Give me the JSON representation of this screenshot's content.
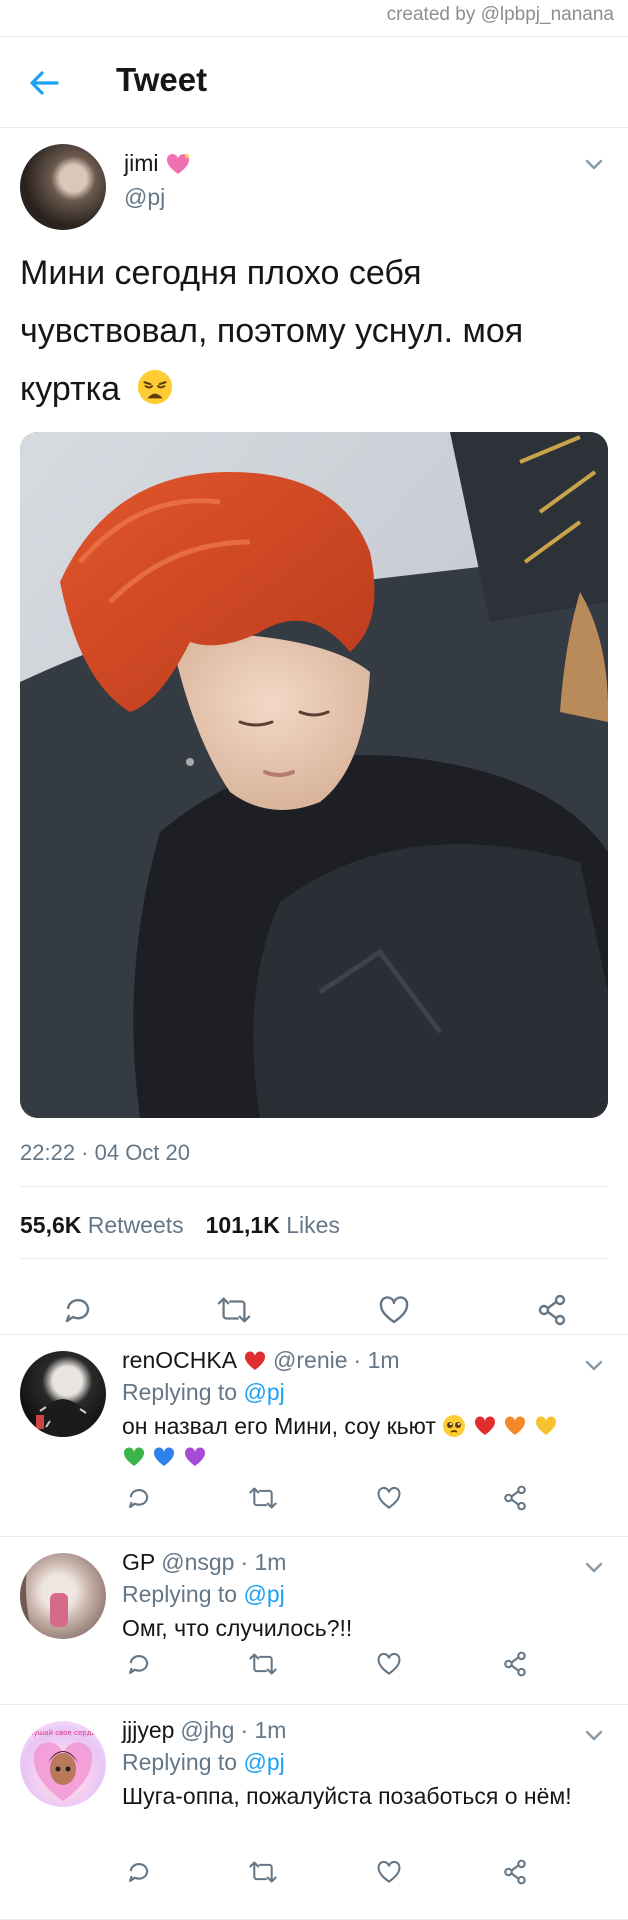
{
  "credit": "created by @lpbpj_nanana",
  "header": {
    "title": "Tweet",
    "back_icon": "arrow-left-icon"
  },
  "tweet": {
    "author_name": "jimi",
    "author_handle": "@pj",
    "text": "Мини сегодня плохо себя чувствовал, поэтому уснул. моя куртка",
    "timestamp": "22:22 · 04 Oct 20",
    "retweets_count": "55,6K",
    "retweets_label": "Retweets",
    "likes_count": "101,1K",
    "likes_label": "Likes"
  },
  "replies": [
    {
      "name": "renOCHKA",
      "handle": "@renie",
      "time": "· 1m",
      "replying_prefix": "Replying to",
      "replying_to": "@pj",
      "text": "он назвал его Мини, соу кьют"
    },
    {
      "name": "GP",
      "handle": "@nsgp",
      "time": "· 1m",
      "replying_prefix": "Replying to",
      "replying_to": "@pj",
      "text": "Омг, что случилось?!!"
    },
    {
      "name": "jjjyep",
      "handle": "@jhg",
      "time": "· 1m",
      "replying_prefix": "Replying to",
      "replying_to": "@pj",
      "text": "Шуга-оппа, пожалуйста позаботься о нём!",
      "avatar_text": "скушай свое сердце"
    }
  ],
  "colors": {
    "accent": "#1da1f2",
    "muted": "#657786",
    "divider": "#e6ecf0"
  }
}
